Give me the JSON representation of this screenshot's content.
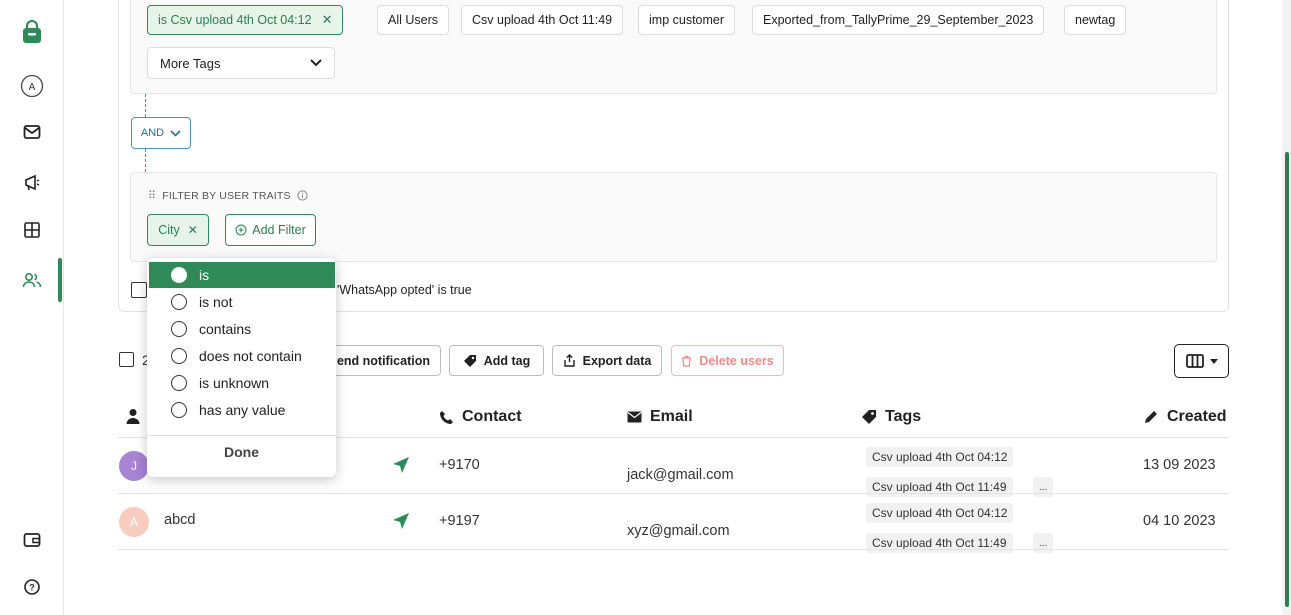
{
  "tags": {
    "selected": "is Csv upload 4th Oct 04:12",
    "items": [
      "All Users",
      "Csv upload 4th Oct 11:49",
      "imp customer",
      "Exported_from_TallyPrime_29_September_2023",
      "newtag"
    ],
    "more_label": "More Tags"
  },
  "logic": {
    "operator": "AND"
  },
  "traits": {
    "title": "FILTER BY USER TRAITS",
    "city_chip": "City",
    "add_filter": "Add Filter"
  },
  "whatsapp_filter_text": "'WhatsApp opted' is true",
  "dropdown": {
    "options": [
      "is",
      "is not",
      "contains",
      "does not contain",
      "is unknown",
      "has any value"
    ],
    "selected_index": 0,
    "done_label": "Done"
  },
  "toolbar": {
    "selected_count_partial": "2",
    "send_notification": "end notification",
    "add_tag": "Add tag",
    "export_data": "Export data",
    "delete_users": "Delete users"
  },
  "table": {
    "headers": {
      "contact": "Contact",
      "email": "Email",
      "tags": "Tags",
      "created": "Created"
    },
    "rows": [
      {
        "avatar_letter": "J",
        "avatar_color": "#a784d4",
        "name": "",
        "contact": "+9170",
        "email": "jack@gmail.com",
        "tags": [
          "Csv upload 4th Oct 04:12",
          "Csv upload 4th Oct 11:49"
        ],
        "more": "...",
        "created": "13 09 2023"
      },
      {
        "avatar_letter": "A",
        "avatar_color": "#f8cdbf",
        "name": "abcd",
        "contact": "+9197",
        "email": "xyz@gmail.com",
        "tags": [
          "Csv upload 4th Oct 04:12",
          "Csv upload 4th Oct 11:49"
        ],
        "more": "...",
        "created": "04 10 2023"
      }
    ]
  },
  "rail": {
    "profile_letter": "A"
  },
  "colors": {
    "brand": "#2e8b57",
    "link": "#4a90c4",
    "danger": "#f08a8a"
  }
}
